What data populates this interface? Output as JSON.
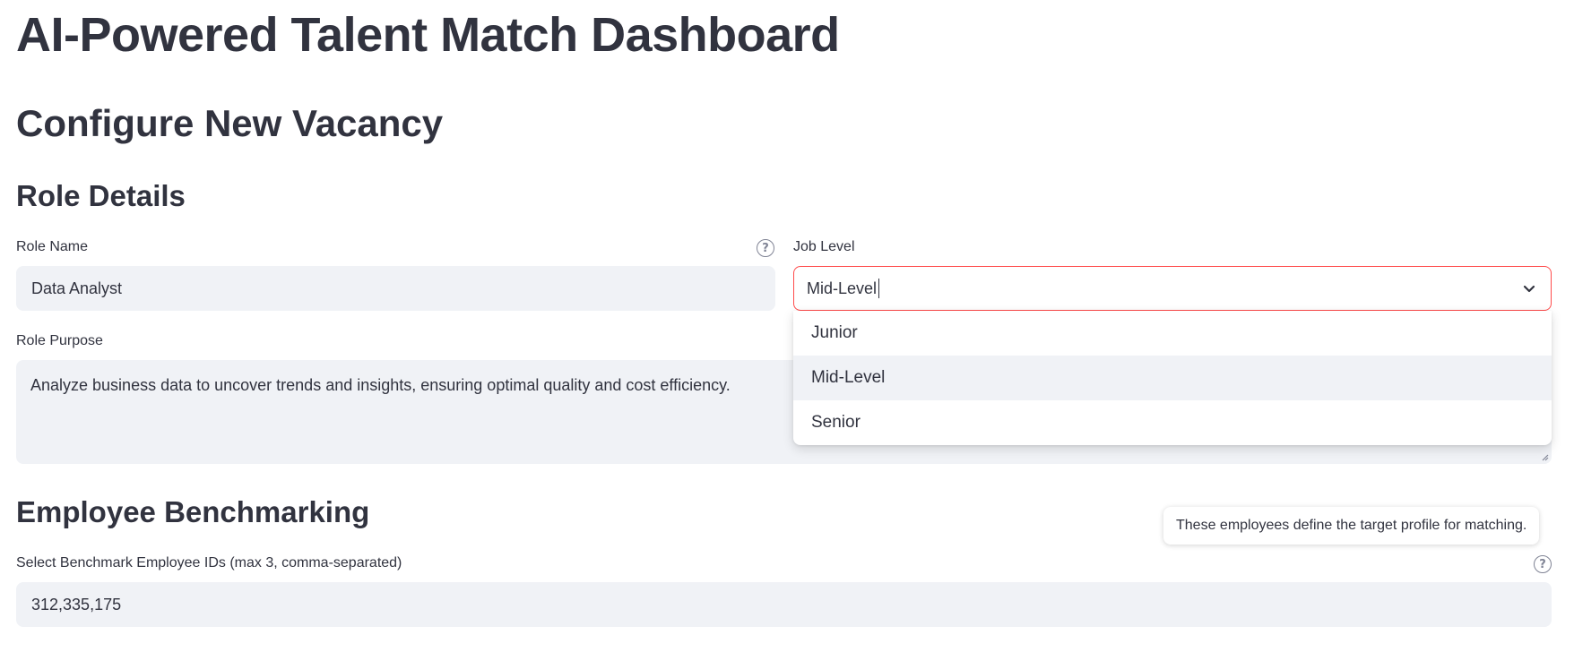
{
  "app_title": "AI-Powered Talent Match Dashboard",
  "section_title": "Configure New Vacancy",
  "role_details": {
    "heading": "Role Details",
    "role_name": {
      "label": "Role Name",
      "value": "Data Analyst"
    },
    "job_level": {
      "label": "Job Level",
      "value": "Mid-Level",
      "options": [
        "Junior",
        "Mid-Level",
        "Senior"
      ],
      "selected_index": 1
    },
    "role_purpose": {
      "label": "Role Purpose",
      "value": "Analyze business data to uncover trends and insights, ensuring optimal quality and cost efficiency."
    }
  },
  "employee_benchmarking": {
    "heading": "Employee Benchmarking",
    "tooltip": "These employees define the target profile for matching.",
    "benchmark_ids": {
      "label": "Select Benchmark Employee IDs (max 3, comma-separated)",
      "value": "312,335,175"
    }
  },
  "colors": {
    "accent": "#ff4b4b",
    "input_bg": "#f0f2f6",
    "text": "#31333f",
    "muted_icon": "#808495"
  },
  "icons": {
    "help": "question-circle-icon",
    "dropdown": "chevron-down-icon",
    "resize": "resize-grip-icon"
  }
}
